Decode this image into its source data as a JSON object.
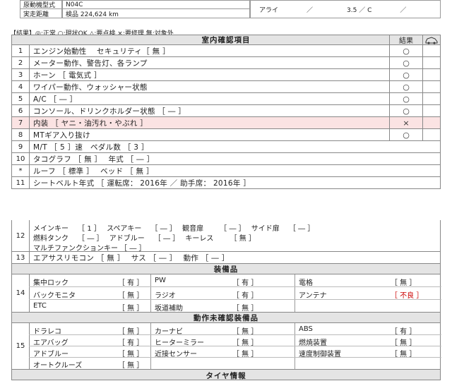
{
  "header": {
    "engine_label": "原動機型式",
    "engine_value": "N04C",
    "mileage_label": "実走距離",
    "mileage_value": "検品 224,624 km",
    "align_label": "アライ",
    "align_sep1": "／",
    "align_value": "3.5 ／ C",
    "align_sep2": "／"
  },
  "legend": "【結果】◎:正常 ○:現状OK △:要点検 ×:要修理 無:対象外",
  "section1": {
    "title": "室内確認項目",
    "result_header": "結果",
    "header_icon": "car-icon",
    "rows": [
      {
        "num": "1",
        "text": "エンジン始動性　 セキュリティ［ 無 ］",
        "result": "○"
      },
      {
        "num": "2",
        "text": "メーター動作、警告灯、各ランプ",
        "result": "○"
      },
      {
        "num": "3",
        "text": "ホーン ［ 電気式 ］",
        "result": "○"
      },
      {
        "num": "4",
        "text": "ワイパー動作、ウォッシャー状態",
        "result": "○"
      },
      {
        "num": "5",
        "text": "A/C ［ ― ］",
        "result": "○"
      },
      {
        "num": "6",
        "text": "コンソール、ドリンクホルダー状態 ［ ― ］",
        "result": "○"
      },
      {
        "num": "7",
        "text": "内装 ［ ヤニ・油汚れ・やぶれ ］",
        "result": "×"
      },
      {
        "num": "8",
        "text": "MTギア入り抜け",
        "result": "○"
      },
      {
        "num": "9",
        "text": "M/T ［ 5 ］速　ペダル数 ［ 3 ］",
        "result": ""
      },
      {
        "num": "10",
        "text": "タコグラフ ［ 無 ］　 年式 ［ ― ］",
        "result": ""
      },
      {
        "num": "*",
        "text": "ルーフ ［ 標準 ］　 ベッド ［ 無 ］",
        "result": ""
      },
      {
        "num": "11",
        "text": "シートベルト年式 ［ 運転席： 2016年 ／ 助手席： 2016年 ］",
        "result": ""
      }
    ],
    "row12": {
      "num": "12",
      "line1": "メインキー　 ［ 1 ］　 スペアキー　 ［ ― ］　 観音扉　　 ［ ― ］　 サイド扉　 ［ ― ］",
      "line2": "燃料タンク　 ［ ― ］　 アドブルー　 ［ ― ］　 キーレス　　 ［ 無 ］",
      "line3": "マルチファンクションキー ［ ― ］"
    },
    "row13": {
      "num": "13",
      "text": "エアサスリモコン ［ 無 ］　 サス ［ ― ］　 動作 ［ ― ］"
    }
  },
  "section2": {
    "title": "装備品",
    "num": "14",
    "rows": [
      [
        {
          "label": "集中ロック",
          "value": "［ 有 ］"
        },
        {
          "label": "PW",
          "value": "［ 有 ］"
        },
        {
          "label": "電格",
          "value": "［ 無 ］"
        }
      ],
      [
        {
          "label": "バックモニタ",
          "value": "［ 無 ］"
        },
        {
          "label": "ラジオ",
          "value": "［ 有 ］"
        },
        {
          "label": "アンテナ",
          "value": "［ 不良 ］"
        }
      ],
      [
        {
          "label": "ETC",
          "value": "［ 無 ］"
        },
        {
          "label": "坂道補助",
          "value": "［ 無 ］"
        },
        {
          "label": "",
          "value": ""
        }
      ]
    ]
  },
  "section3": {
    "title": "動作未確認装備品",
    "num": "15",
    "rows": [
      [
        {
          "label": "ドラレコ",
          "value": "［ 無 ］"
        },
        {
          "label": "カーナビ",
          "value": "［ 無 ］"
        },
        {
          "label": "ABS",
          "value": "［ 有 ］"
        }
      ],
      [
        {
          "label": "エアバッグ",
          "value": "［ 有 ］"
        },
        {
          "label": "ヒーターミラー",
          "value": "［ 無 ］"
        },
        {
          "label": "燃焼装置",
          "value": "［ 無 ］"
        }
      ],
      [
        {
          "label": "アドブルー",
          "value": "［ 無 ］"
        },
        {
          "label": "近接センサー",
          "value": "［ 無 ］"
        },
        {
          "label": "速度制御装置",
          "value": "［ 無 ］"
        }
      ],
      [
        {
          "label": "オートクルーズ",
          "value": "［ 無 ］"
        },
        {
          "label": "",
          "value": ""
        },
        {
          "label": "",
          "value": ""
        }
      ]
    ]
  },
  "footer_title": "タイヤ情報",
  "colors": {
    "highlight_row": "#fbe3e3",
    "header_bg": "#e4e4e4",
    "bad_text": "#cc0000"
  }
}
